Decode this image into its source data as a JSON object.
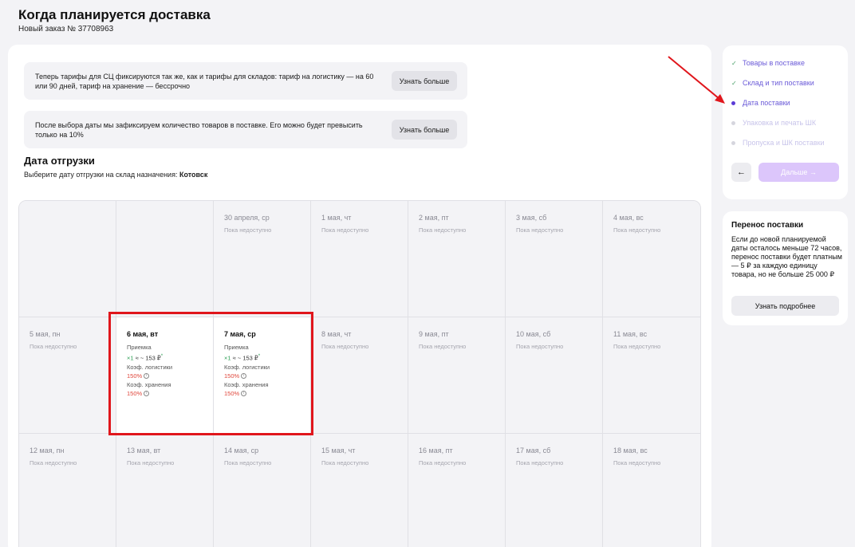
{
  "header": {
    "title": "Когда планируется доставка",
    "order_number": "Новый заказ № 37708963"
  },
  "notices": [
    {
      "text": "Теперь тарифы для СЦ фиксируются так же, как и тарифы для складов: тариф на логистику — на 60 или 90 дней, тариф на хранение — бессрочно",
      "button": "Узнать больше"
    },
    {
      "text": "После выбора даты мы зафиксируем количество товаров в поставке. Его можно будет превысить только на 10%",
      "button": "Узнать больше"
    }
  ],
  "shipment": {
    "title": "Дата отгрузки",
    "subtitle_prefix": "Выберите дату отгрузки на склад назначения: ",
    "warehouse": "Котовск"
  },
  "calendar": {
    "rows": [
      [
        {
          "empty": true
        },
        {
          "empty": true
        },
        {
          "date": "30 апреля, ср",
          "status": "Пока недоступно"
        },
        {
          "date": "1 мая, чт",
          "status": "Пока недоступно"
        },
        {
          "date": "2 мая, пт",
          "status": "Пока недоступно"
        },
        {
          "date": "3 мая, сб",
          "status": "Пока недоступно"
        },
        {
          "date": "4 мая, вс",
          "status": "Пока недоступно"
        }
      ],
      [
        {
          "date": "5 мая, пн",
          "status": "Пока недоступно"
        },
        {
          "date": "6 мая, вт",
          "available": true,
          "acceptance_label": "Приемка",
          "multiplier": "×1",
          "price": "≈ ~ 153 ₽",
          "price_mark": "*",
          "logistics_label": "Коэф. логистики",
          "logistics_value": "150%",
          "storage_label": "Коэф. хранения",
          "storage_value": "150%"
        },
        {
          "date": "7 мая, ср",
          "available": true,
          "acceptance_label": "Приемка",
          "multiplier": "×1",
          "price": "≈ ~ 153 ₽",
          "price_mark": "*",
          "logistics_label": "Коэф. логистики",
          "logistics_value": "150%",
          "storage_label": "Коэф. хранения",
          "storage_value": "150%"
        },
        {
          "date": "8 мая, чт",
          "status": "Пока недоступно"
        },
        {
          "date": "9 мая, пт",
          "status": "Пока недоступно"
        },
        {
          "date": "10 мая, сб",
          "status": "Пока недоступно"
        },
        {
          "date": "11 мая, вс",
          "status": "Пока недоступно"
        }
      ],
      [
        {
          "date": "12 мая, пн",
          "status": "Пока недоступно"
        },
        {
          "date": "13 мая, вт",
          "status": "Пока недоступно"
        },
        {
          "date": "14 мая, ср",
          "status": "Пока недоступно"
        },
        {
          "date": "15 мая, чт",
          "status": "Пока недоступно"
        },
        {
          "date": "16 мая, пт",
          "status": "Пока недоступно"
        },
        {
          "date": "17 мая, сб",
          "status": "Пока недоступно"
        },
        {
          "date": "18 мая, вс",
          "status": "Пока недоступно"
        }
      ]
    ]
  },
  "steps": {
    "items": [
      {
        "label": "Товары в поставке",
        "state": "done"
      },
      {
        "label": "Склад и тип поставки",
        "state": "done"
      },
      {
        "label": "Дата поставки",
        "state": "current"
      },
      {
        "label": "Упаковка и печать ШК",
        "state": "todo"
      },
      {
        "label": "Пропуска и ШК поставки",
        "state": "todo"
      }
    ],
    "back_icon": "←",
    "next_label": "Дальше →"
  },
  "transfer": {
    "title": "Перенос поставки",
    "text": "Если до новой планируемой даты осталось меньше 72 часов, перенос поставки будет платным — 5 ₽ за каждую единицу товара, но не больше 25 000 ₽",
    "button": "Узнать подробнее"
  },
  "colors": {
    "accent": "#6a5ad8",
    "highlight": "#e0161c",
    "next_button": "#dcc6fb",
    "percent": "#e0473c"
  }
}
